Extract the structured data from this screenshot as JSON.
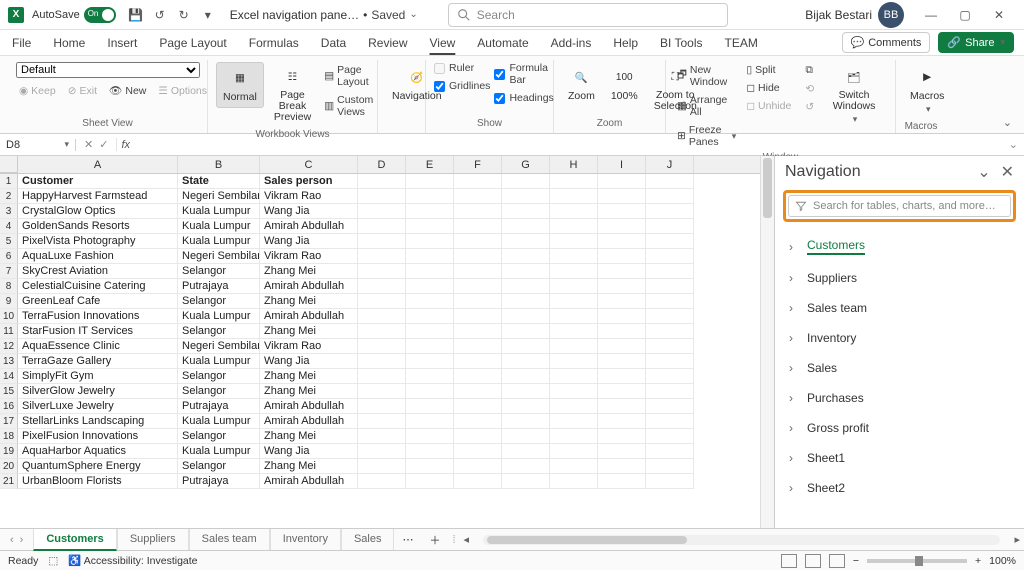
{
  "titlebar": {
    "autosave_label": "AutoSave",
    "autosave_on": "On",
    "filename": "Excel navigation pane…",
    "saved_status": "Saved",
    "search_placeholder": "Search",
    "username": "Bijak Bestari",
    "avatar_initials": "BB"
  },
  "menutabs": [
    "File",
    "Home",
    "Insert",
    "Page Layout",
    "Formulas",
    "Data",
    "Review",
    "View",
    "Automate",
    "Add-ins",
    "Help",
    "BI Tools",
    "TEAM"
  ],
  "menutabs_active": "View",
  "comments_btn": "Comments",
  "share_btn": "Share",
  "ribbon": {
    "sheet_view": {
      "default": "Default",
      "keep": "Keep",
      "exit": "Exit",
      "new": "New",
      "options": "Options",
      "label": "Sheet View"
    },
    "workbook_views": {
      "normal": "Normal",
      "pagebreak": "Page Break Preview",
      "pagelayout": "Page Layout",
      "custom": "Custom Views",
      "label": "Workbook Views"
    },
    "nav": {
      "navigation": "Navigation"
    },
    "show": {
      "ruler": "Ruler",
      "gridlines": "Gridlines",
      "formula": "Formula Bar",
      "headings": "Headings",
      "label": "Show"
    },
    "zoom": {
      "zoom": "Zoom",
      "hundred": "100%",
      "selection": "Zoom to Selection",
      "label": "Zoom"
    },
    "window": {
      "newwin": "New Window",
      "arrange": "Arrange All",
      "freeze": "Freeze Panes",
      "split": "Split",
      "hide": "Hide",
      "unhide": "Unhide",
      "switch": "Switch Windows",
      "label": "Window"
    },
    "macros": {
      "macros": "Macros",
      "label": "Macros"
    }
  },
  "namebox": "D8",
  "columns": [
    "A",
    "B",
    "C",
    "D",
    "E",
    "F",
    "G",
    "H",
    "I",
    "J"
  ],
  "headers": {
    "A": "Customer",
    "B": "State",
    "C": "Sales person"
  },
  "data_rows": [
    {
      "A": "HappyHarvest Farmstead",
      "B": "Negeri Sembilan",
      "C": "Vikram Rao"
    },
    {
      "A": "CrystalGlow Optics",
      "B": "Kuala Lumpur",
      "C": "Wang Jia"
    },
    {
      "A": "GoldenSands Resorts",
      "B": "Kuala Lumpur",
      "C": "Amirah Abdullah"
    },
    {
      "A": "PixelVista Photography",
      "B": "Kuala Lumpur",
      "C": "Wang Jia"
    },
    {
      "A": "AquaLuxe Fashion",
      "B": "Negeri Sembilan",
      "C": "Vikram Rao"
    },
    {
      "A": "SkyCrest Aviation",
      "B": "Selangor",
      "C": "Zhang Mei"
    },
    {
      "A": "CelestialCuisine Catering",
      "B": "Putrajaya",
      "C": "Amirah Abdullah"
    },
    {
      "A": "GreenLeaf Cafe",
      "B": "Selangor",
      "C": "Zhang Mei"
    },
    {
      "A": "TerraFusion Innovations",
      "B": "Kuala Lumpur",
      "C": "Amirah Abdullah"
    },
    {
      "A": "StarFusion IT Services",
      "B": "Selangor",
      "C": "Zhang Mei"
    },
    {
      "A": "AquaEssence Clinic",
      "B": "Negeri Sembilan",
      "C": "Vikram Rao"
    },
    {
      "A": "TerraGaze Gallery",
      "B": "Kuala Lumpur",
      "C": "Wang Jia"
    },
    {
      "A": "SimplyFit Gym",
      "B": "Selangor",
      "C": "Zhang Mei"
    },
    {
      "A": "SilverGlow Jewelry",
      "B": "Selangor",
      "C": "Zhang Mei"
    },
    {
      "A": "SilverLuxe Jewelry",
      "B": "Putrajaya",
      "C": "Amirah Abdullah"
    },
    {
      "A": "StellarLinks Landscaping",
      "B": "Kuala Lumpur",
      "C": "Amirah Abdullah"
    },
    {
      "A": "PixelFusion Innovations",
      "B": "Selangor",
      "C": "Zhang Mei"
    },
    {
      "A": "AquaHarbor Aquatics",
      "B": "Kuala Lumpur",
      "C": "Wang Jia"
    },
    {
      "A": "QuantumSphere Energy",
      "B": "Selangor",
      "C": "Zhang Mei"
    },
    {
      "A": "UrbanBloom Florists",
      "B": "Putrajaya",
      "C": "Amirah Abdullah"
    }
  ],
  "navpane": {
    "title": "Navigation",
    "search_placeholder": "Search for tables, charts, and more…",
    "items": [
      "Customers",
      "Suppliers",
      "Sales team",
      "Inventory",
      "Sales",
      "Purchases",
      "Gross profit",
      "Sheet1",
      "Sheet2"
    ],
    "active": "Customers"
  },
  "sheets": [
    "Customers",
    "Suppliers",
    "Sales team",
    "Inventory",
    "Sales"
  ],
  "sheets_active": "Customers",
  "statusbar": {
    "ready": "Ready",
    "access": "Accessibility: Investigate",
    "zoom": "100%"
  }
}
